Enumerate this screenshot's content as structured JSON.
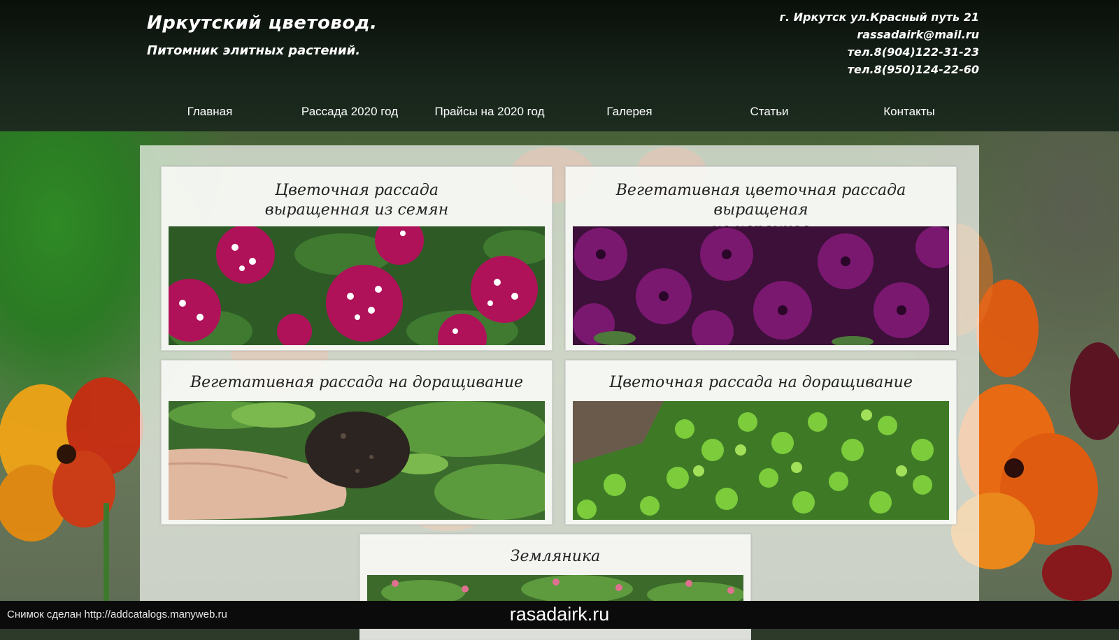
{
  "header": {
    "title": "Иркутский цветовод.",
    "subtitle": "Питомник элитных растений.",
    "contacts": [
      "г. Иркутск ул.Красный путь 21",
      "rassadairk@mail.ru",
      "тел.8(904)122-31-23",
      "тел.8(950)124-22-60"
    ]
  },
  "nav": {
    "items": [
      {
        "label": "Главная"
      },
      {
        "label": "Рассада 2020 год"
      },
      {
        "label": "Прайсы на 2020 год"
      },
      {
        "label": "Галерея"
      },
      {
        "label": "Статьи"
      },
      {
        "label": "Контакты"
      }
    ]
  },
  "cards": [
    {
      "title_line1": "Цветочная рассада",
      "title_line2": "выращенная из семян",
      "image": "verbena-flowers-photo"
    },
    {
      "title_line1": "Вегетативная цветочная рассада выращеная",
      "title_line2": "из черенков",
      "image": "petunia-flowers-photo"
    },
    {
      "title_line1": "Вегетативная рассада на доращивание",
      "image": "seedling-plug-in-hand-photo"
    },
    {
      "title_line1": "Цветочная рассада на доращивание",
      "image": "green-seedlings-tray-photo"
    },
    {
      "title_line1": "Земляника",
      "image": "strawberry-plants-photo"
    }
  ],
  "footer": {
    "snapshot_note": "Снимок сделан http://addcatalogs.manyweb.ru",
    "domain": "rasadairk.ru"
  },
  "colors": {
    "header_bg": "#0f1a12",
    "panel_bg": "#f3f6f0",
    "bottom_bar": "#0b0b0b"
  }
}
